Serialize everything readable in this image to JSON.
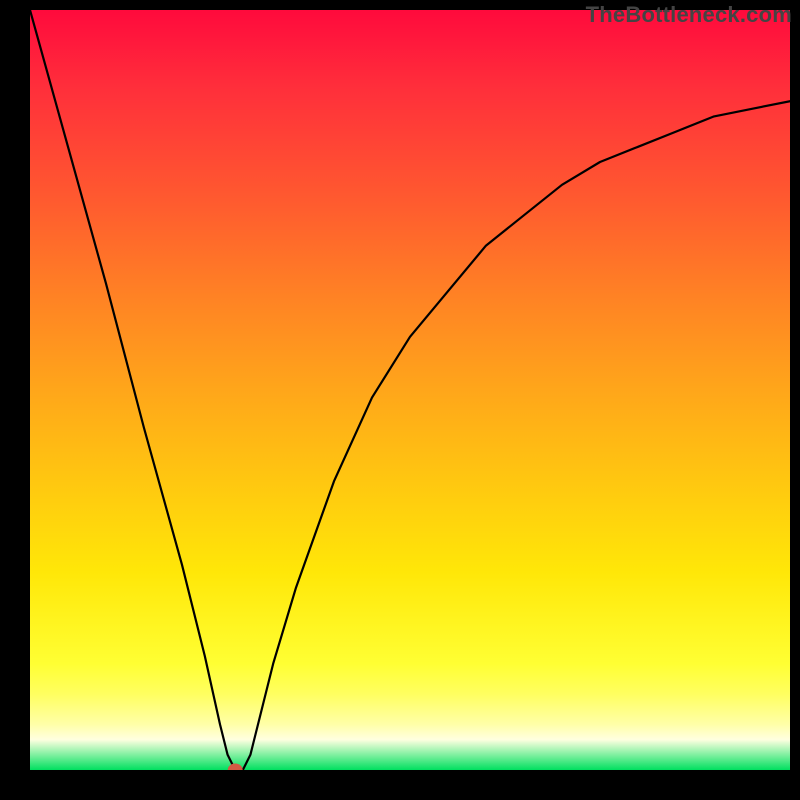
{
  "watermark": "TheBottleneck.com",
  "chart_data": {
    "type": "line",
    "title": "",
    "xlabel": "",
    "ylabel": "",
    "xlim": [
      0,
      100
    ],
    "ylim": [
      0,
      100
    ],
    "grid": false,
    "legend": false,
    "series": [
      {
        "name": "bottleneck-curve",
        "x": [
          0,
          5,
          10,
          15,
          20,
          23,
          25,
          26,
          27,
          28,
          29,
          30,
          32,
          35,
          40,
          45,
          50,
          55,
          60,
          65,
          70,
          75,
          80,
          85,
          90,
          95,
          100
        ],
        "y": [
          100,
          82,
          64,
          45,
          27,
          15,
          6,
          2,
          0,
          0,
          2,
          6,
          14,
          24,
          38,
          49,
          57,
          63,
          69,
          73,
          77,
          80,
          82,
          84,
          86,
          87,
          88
        ]
      }
    ],
    "markers": [
      {
        "name": "optimal-point",
        "x": 27,
        "y": 0,
        "color": "#d25a44"
      }
    ],
    "gradient_stops": [
      {
        "pos": 0,
        "color": "#ff0a3c"
      },
      {
        "pos": 10,
        "color": "#ff2e3b"
      },
      {
        "pos": 25,
        "color": "#ff5a2f"
      },
      {
        "pos": 38,
        "color": "#ff8324"
      },
      {
        "pos": 50,
        "color": "#ffa61a"
      },
      {
        "pos": 62,
        "color": "#ffc710"
      },
      {
        "pos": 74,
        "color": "#ffe708"
      },
      {
        "pos": 86,
        "color": "#ffff33"
      },
      {
        "pos": 90,
        "color": "#ffff60"
      },
      {
        "pos": 94,
        "color": "#ffffa8"
      },
      {
        "pos": 96,
        "color": "#ffffe0"
      },
      {
        "pos": 100,
        "color": "#00e060"
      }
    ]
  }
}
